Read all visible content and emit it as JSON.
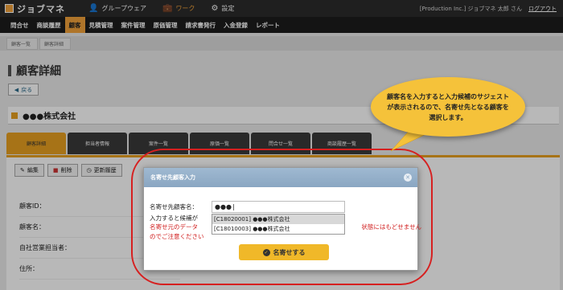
{
  "header": {
    "app_name": "ジョブマネ",
    "apps": [
      {
        "label": "グループウェア",
        "icon": "user-icon",
        "active": false
      },
      {
        "label": "ワーク",
        "icon": "briefcase-icon",
        "active": true
      },
      {
        "label": "設定",
        "icon": "gear-icon",
        "active": false
      }
    ],
    "user_info": "[Production Inc.] ジョブマネ 太郎 さん",
    "logout_label": "ログアウト"
  },
  "subnav": {
    "items": [
      "問合せ",
      "商談履歴",
      "顧客",
      "見積管理",
      "案件管理",
      "原価管理",
      "請求書発行",
      "入金登録",
      "レポート"
    ],
    "active_index": 2
  },
  "breadcrumb": [
    "顧客一覧",
    "顧客詳細"
  ],
  "page": {
    "title": "顧客詳細",
    "back_label": "戻る",
    "company_name": "●●●株式会社"
  },
  "tabs": [
    "顧客詳細",
    "担当者情報",
    "案件一覧",
    "原価一覧",
    "問合せ一覧",
    "商談履歴一覧"
  ],
  "actions": [
    "編集",
    "削除",
    "更新履歴"
  ],
  "fields": [
    "顧客ID：",
    "顧客名：",
    "自社営業担当者：",
    "住所："
  ],
  "modal": {
    "title": "名寄せ先顧客入力",
    "input_label": "名寄せ先顧客名：",
    "input_value": "●●●",
    "note_prefix": "入力すると候補が",
    "note_warning_left": "名寄せ元のデータ",
    "note_warning_right": "状態にはもどせません",
    "note_warning_line2": "のでご注意ください",
    "suggestions": [
      "[C18020001] ●●●株式会社",
      "[C18010003] ●●●株式会社"
    ],
    "merge_button": "名寄せする"
  },
  "callout": {
    "text": "顧客名を入力すると入力候補のサジェストが表示されるので、名寄せ先となる顧客を選択します。"
  },
  "colors": {
    "accent": "#f3a33b",
    "highlight_outline": "#d62020",
    "callout_fill": "#f5c23a"
  }
}
